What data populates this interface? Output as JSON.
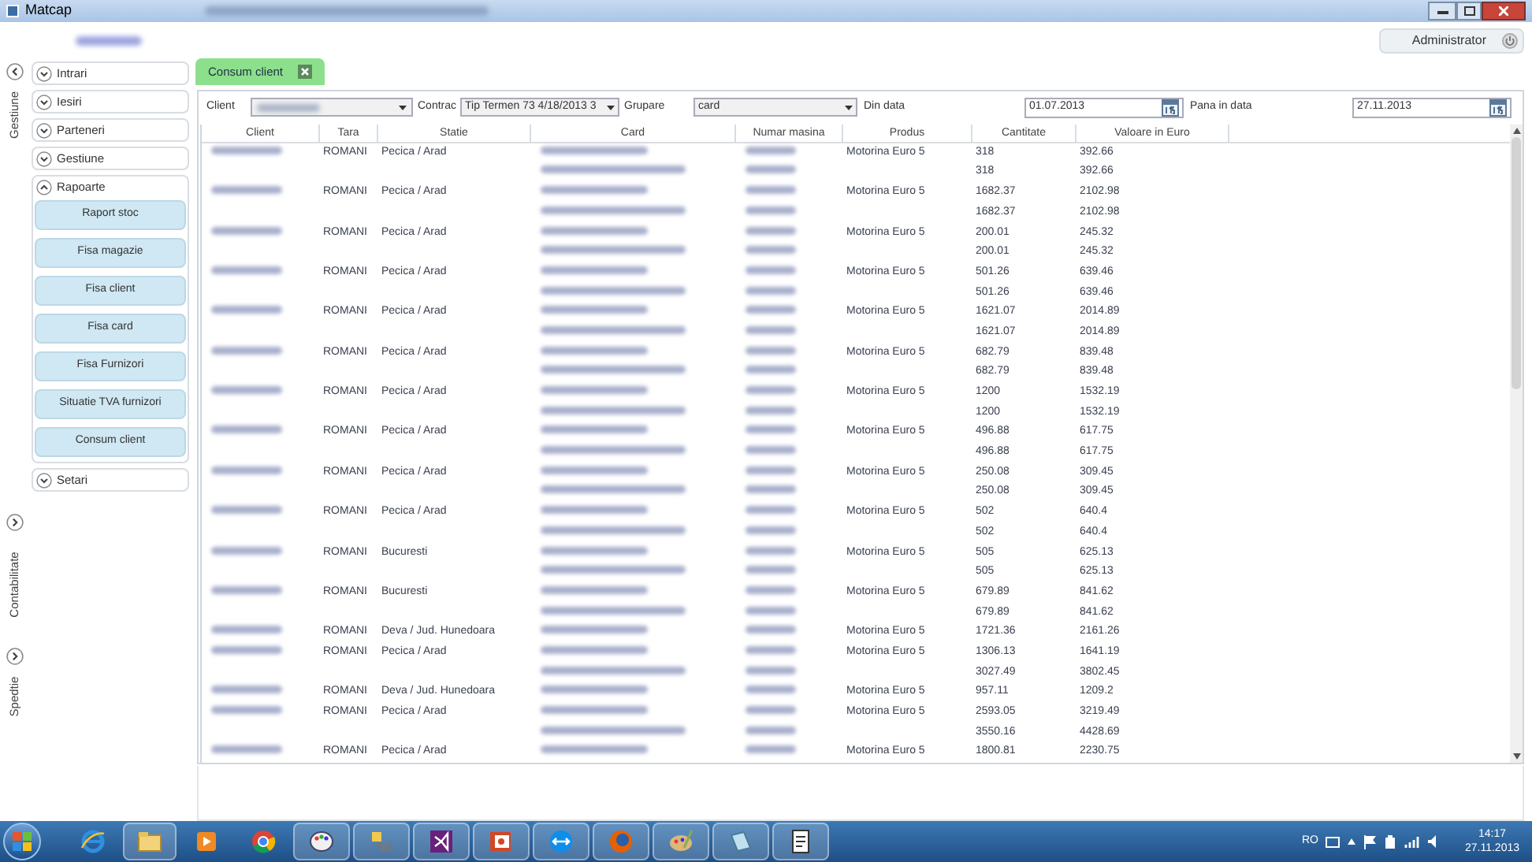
{
  "window": {
    "title": "Matcap"
  },
  "user_button": {
    "label": "Administrator"
  },
  "side_tabs": [
    {
      "label": "Gestiune",
      "expanded": true
    },
    {
      "label": "Contabilitate",
      "expanded": false
    },
    {
      "label": "Spedtie",
      "expanded": false
    }
  ],
  "accordion": [
    {
      "label": "Intrari",
      "expanded": false
    },
    {
      "label": "Iesiri",
      "expanded": false
    },
    {
      "label": "Parteneri",
      "expanded": false
    },
    {
      "label": "Gestiune",
      "expanded": false
    },
    {
      "label": "Rapoarte",
      "expanded": true,
      "items": [
        "Raport stoc",
        "Fisa magazie",
        "Fisa client",
        "Fisa card",
        "Fisa Furnizori",
        "Situatie TVA furnizori",
        "Consum client"
      ]
    },
    {
      "label": "Setari",
      "expanded": false
    }
  ],
  "tabs": [
    {
      "label": "Consum client",
      "selected": true
    }
  ],
  "filters": {
    "client_label": "Client",
    "contract_label": "Contrac",
    "contract_value": "Tip Termen 73 4/18/2013 3",
    "grouping_label": "Grupare",
    "grouping_value": "card",
    "from_label": "Din data",
    "from_value": "01.07.2013",
    "to_label": "Pana in data",
    "to_value": "27.11.2013"
  },
  "table": {
    "columns": [
      "Client",
      "Tara",
      "Statie",
      "Card",
      "Numar masina",
      "Produs",
      "Cantitate",
      "Valoare in Euro"
    ],
    "rows": [
      {
        "kind": "detail",
        "tara": "ROMANI",
        "statie": "Pecica / Arad",
        "produs": "Motorina Euro 5",
        "cantitate": "318",
        "valoare": "392.66"
      },
      {
        "kind": "total",
        "cantitate": "318",
        "valoare": "392.66"
      },
      {
        "kind": "detail",
        "tara": "ROMANI",
        "statie": "Pecica / Arad",
        "produs": "Motorina Euro 5",
        "cantitate": "1682.37",
        "valoare": "2102.98"
      },
      {
        "kind": "total",
        "cantitate": "1682.37",
        "valoare": "2102.98"
      },
      {
        "kind": "detail",
        "tara": "ROMANI",
        "statie": "Pecica / Arad",
        "produs": "Motorina Euro 5",
        "cantitate": "200.01",
        "valoare": "245.32"
      },
      {
        "kind": "total",
        "cantitate": "200.01",
        "valoare": "245.32"
      },
      {
        "kind": "detail",
        "tara": "ROMANI",
        "statie": "Pecica / Arad",
        "produs": "Motorina Euro 5",
        "cantitate": "501.26",
        "valoare": "639.46"
      },
      {
        "kind": "total",
        "cantitate": "501.26",
        "valoare": "639.46"
      },
      {
        "kind": "detail",
        "tara": "ROMANI",
        "statie": "Pecica / Arad",
        "produs": "Motorina Euro 5",
        "cantitate": "1621.07",
        "valoare": "2014.89"
      },
      {
        "kind": "total",
        "cantitate": "1621.07",
        "valoare": "2014.89"
      },
      {
        "kind": "detail",
        "tara": "ROMANI",
        "statie": "Pecica / Arad",
        "produs": "Motorina Euro 5",
        "cantitate": "682.79",
        "valoare": "839.48"
      },
      {
        "kind": "total",
        "cantitate": "682.79",
        "valoare": "839.48"
      },
      {
        "kind": "detail",
        "tara": "ROMANI",
        "statie": "Pecica / Arad",
        "produs": "Motorina Euro 5",
        "cantitate": "1200",
        "valoare": "1532.19"
      },
      {
        "kind": "total",
        "cantitate": "1200",
        "valoare": "1532.19"
      },
      {
        "kind": "detail",
        "tara": "ROMANI",
        "statie": "Pecica / Arad",
        "produs": "Motorina Euro 5",
        "cantitate": "496.88",
        "valoare": "617.75"
      },
      {
        "kind": "total",
        "cantitate": "496.88",
        "valoare": "617.75"
      },
      {
        "kind": "detail",
        "tara": "ROMANI",
        "statie": "Pecica / Arad",
        "produs": "Motorina Euro 5",
        "cantitate": "250.08",
        "valoare": "309.45"
      },
      {
        "kind": "total",
        "cantitate": "250.08",
        "valoare": "309.45"
      },
      {
        "kind": "detail",
        "tara": "ROMANI",
        "statie": "Pecica / Arad",
        "produs": "Motorina Euro 5",
        "cantitate": "502",
        "valoare": "640.4"
      },
      {
        "kind": "total",
        "cantitate": "502",
        "valoare": "640.4"
      },
      {
        "kind": "detail",
        "tara": "ROMANI",
        "statie": "Bucuresti",
        "produs": "Motorina Euro 5",
        "cantitate": "505",
        "valoare": "625.13"
      },
      {
        "kind": "total",
        "cantitate": "505",
        "valoare": "625.13"
      },
      {
        "kind": "detail",
        "tara": "ROMANI",
        "statie": "Bucuresti",
        "produs": "Motorina Euro 5",
        "cantitate": "679.89",
        "valoare": "841.62"
      },
      {
        "kind": "total",
        "cantitate": "679.89",
        "valoare": "841.62"
      },
      {
        "kind": "detail",
        "tara": "ROMANI",
        "statie": "Deva / Jud. Hunedoara",
        "produs": "Motorina Euro 5",
        "cantitate": "1721.36",
        "valoare": "2161.26"
      },
      {
        "kind": "detail",
        "tara": "ROMANI",
        "statie": "Pecica / Arad",
        "produs": "Motorina Euro 5",
        "cantitate": "1306.13",
        "valoare": "1641.19"
      },
      {
        "kind": "total",
        "cantitate": "3027.49",
        "valoare": "3802.45"
      },
      {
        "kind": "detail",
        "tara": "ROMANI",
        "statie": "Deva / Jud. Hunedoara",
        "produs": "Motorina Euro 5",
        "cantitate": "957.11",
        "valoare": "1209.2"
      },
      {
        "kind": "detail",
        "tara": "ROMANI",
        "statie": "Pecica / Arad",
        "produs": "Motorina Euro 5",
        "cantitate": "2593.05",
        "valoare": "3219.49"
      },
      {
        "kind": "total",
        "cantitate": "3550.16",
        "valoare": "4428.69"
      },
      {
        "kind": "detail",
        "tara": "ROMANI",
        "statie": "Pecica / Arad",
        "produs": "Motorina Euro 5",
        "cantitate": "1800.81",
        "valoare": "2230.75"
      }
    ]
  },
  "taskbar": {
    "language": "RO",
    "time": "14:17",
    "date": "27.11.2013"
  }
}
